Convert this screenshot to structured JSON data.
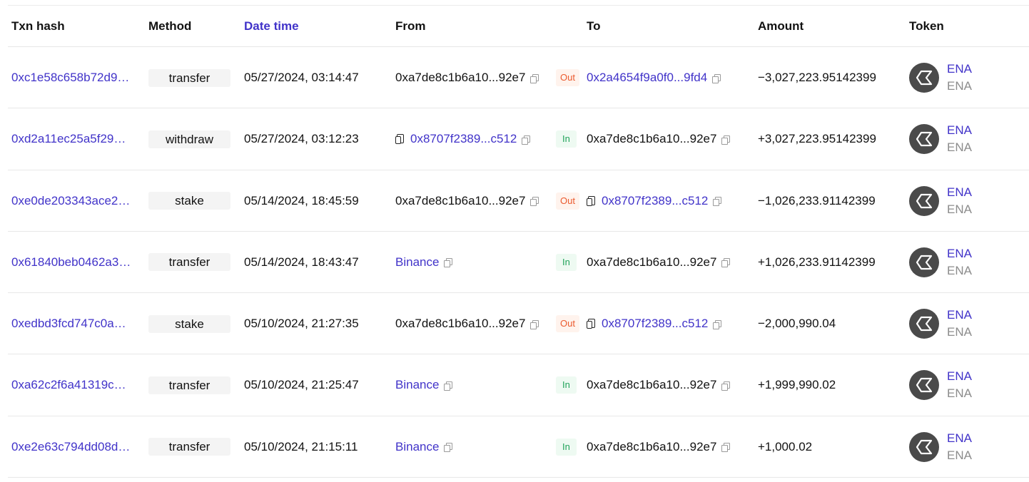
{
  "headers": {
    "txn_hash": "Txn hash",
    "method": "Method",
    "date_time": "Date time",
    "from": "From",
    "to": "To",
    "amount": "Amount",
    "token": "Token"
  },
  "colors": {
    "link": "#4133c9",
    "out": "#eb5a2e",
    "in": "#20a35a",
    "token_icon_bg": "#4a4a4a"
  },
  "rows": [
    {
      "hash": "0xc1e58c658b72d9…",
      "method": "transfer",
      "datetime": "05/27/2024, 03:14:47",
      "from": "0xa7de8c1b6a10...92e7",
      "direction": "Out",
      "to": "0x2a4654f9a0f0...9fd4",
      "amount": "−3,027,223.95142399",
      "token_symbol": "ENA",
      "token_name": "ENA"
    },
    {
      "hash": "0xd2a11ec25a5f29…",
      "method": "withdraw",
      "datetime": "05/27/2024, 03:12:23",
      "from": "0x8707f2389...c512",
      "direction": "In",
      "to": "0xa7de8c1b6a10...92e7",
      "amount": "+3,027,223.95142399",
      "token_symbol": "ENA",
      "token_name": "ENA"
    },
    {
      "hash": "0xe0de203343ace2…",
      "method": "stake",
      "datetime": "05/14/2024, 18:45:59",
      "from": "0xa7de8c1b6a10...92e7",
      "direction": "Out",
      "to": "0x8707f2389...c512",
      "amount": "−1,026,233.91142399",
      "token_symbol": "ENA",
      "token_name": "ENA"
    },
    {
      "hash": "0x61840beb0462a3…",
      "method": "transfer",
      "datetime": "05/14/2024, 18:43:47",
      "from": "Binance",
      "direction": "In",
      "to": "0xa7de8c1b6a10...92e7",
      "amount": "+1,026,233.91142399",
      "token_symbol": "ENA",
      "token_name": "ENA"
    },
    {
      "hash": "0xedbd3fcd747c0a…",
      "method": "stake",
      "datetime": "05/10/2024, 21:27:35",
      "from": "0xa7de8c1b6a10...92e7",
      "direction": "Out",
      "to": "0x8707f2389...c512",
      "amount": "−2,000,990.04",
      "token_symbol": "ENA",
      "token_name": "ENA"
    },
    {
      "hash": "0xa62c2f6a41319c…",
      "method": "transfer",
      "datetime": "05/10/2024, 21:25:47",
      "from": "Binance",
      "direction": "In",
      "to": "0xa7de8c1b6a10...92e7",
      "amount": "+1,999,990.02",
      "token_symbol": "ENA",
      "token_name": "ENA"
    },
    {
      "hash": "0xe2e63c794dd08d…",
      "method": "transfer",
      "datetime": "05/10/2024, 21:15:11",
      "from": "Binance",
      "direction": "In",
      "to": "0xa7de8c1b6a10...92e7",
      "amount": "+1,000.02",
      "token_symbol": "ENA",
      "token_name": "ENA"
    }
  ]
}
